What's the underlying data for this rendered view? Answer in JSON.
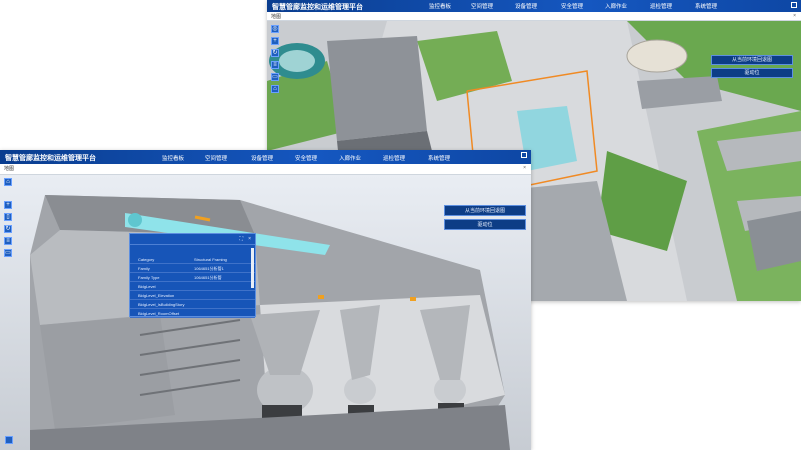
{
  "app_title": "智慧管廊监控和运维管理平台",
  "nav": [
    "监控看板",
    "空间管理",
    "设备管理",
    "安全管理",
    "入廊作业",
    "巡检管理",
    "系统管理"
  ],
  "tab_label": "地图",
  "tab_close": "×",
  "right_buttons": [
    "从当前环境回退图",
    "驱动位"
  ],
  "properties": {
    "rows": [
      {
        "key": "Category",
        "value": "Structural Framing"
      },
      {
        "key": "Family",
        "value": "1064651分析管1"
      },
      {
        "key": "Family Type",
        "value": "1064651分析管"
      },
      {
        "key": "BldgLevel",
        "value": ""
      },
      {
        "key": "BldgLevel_Elevation",
        "value": ""
      },
      {
        "key": "BldgLevel_IsBuildingStory",
        "value": ""
      },
      {
        "key": "BldgLevel_RoomOffset",
        "value": ""
      }
    ]
  },
  "icons": {
    "tool1": "compass-icon",
    "tool2": "pan-icon",
    "tool3": "rotate-icon",
    "tool4": "layer-icon",
    "tool5": "measure-icon"
  },
  "colors": {
    "titlebar": "#1557c0",
    "panel": "#1755b8",
    "button_bg": "#0d3d86"
  }
}
